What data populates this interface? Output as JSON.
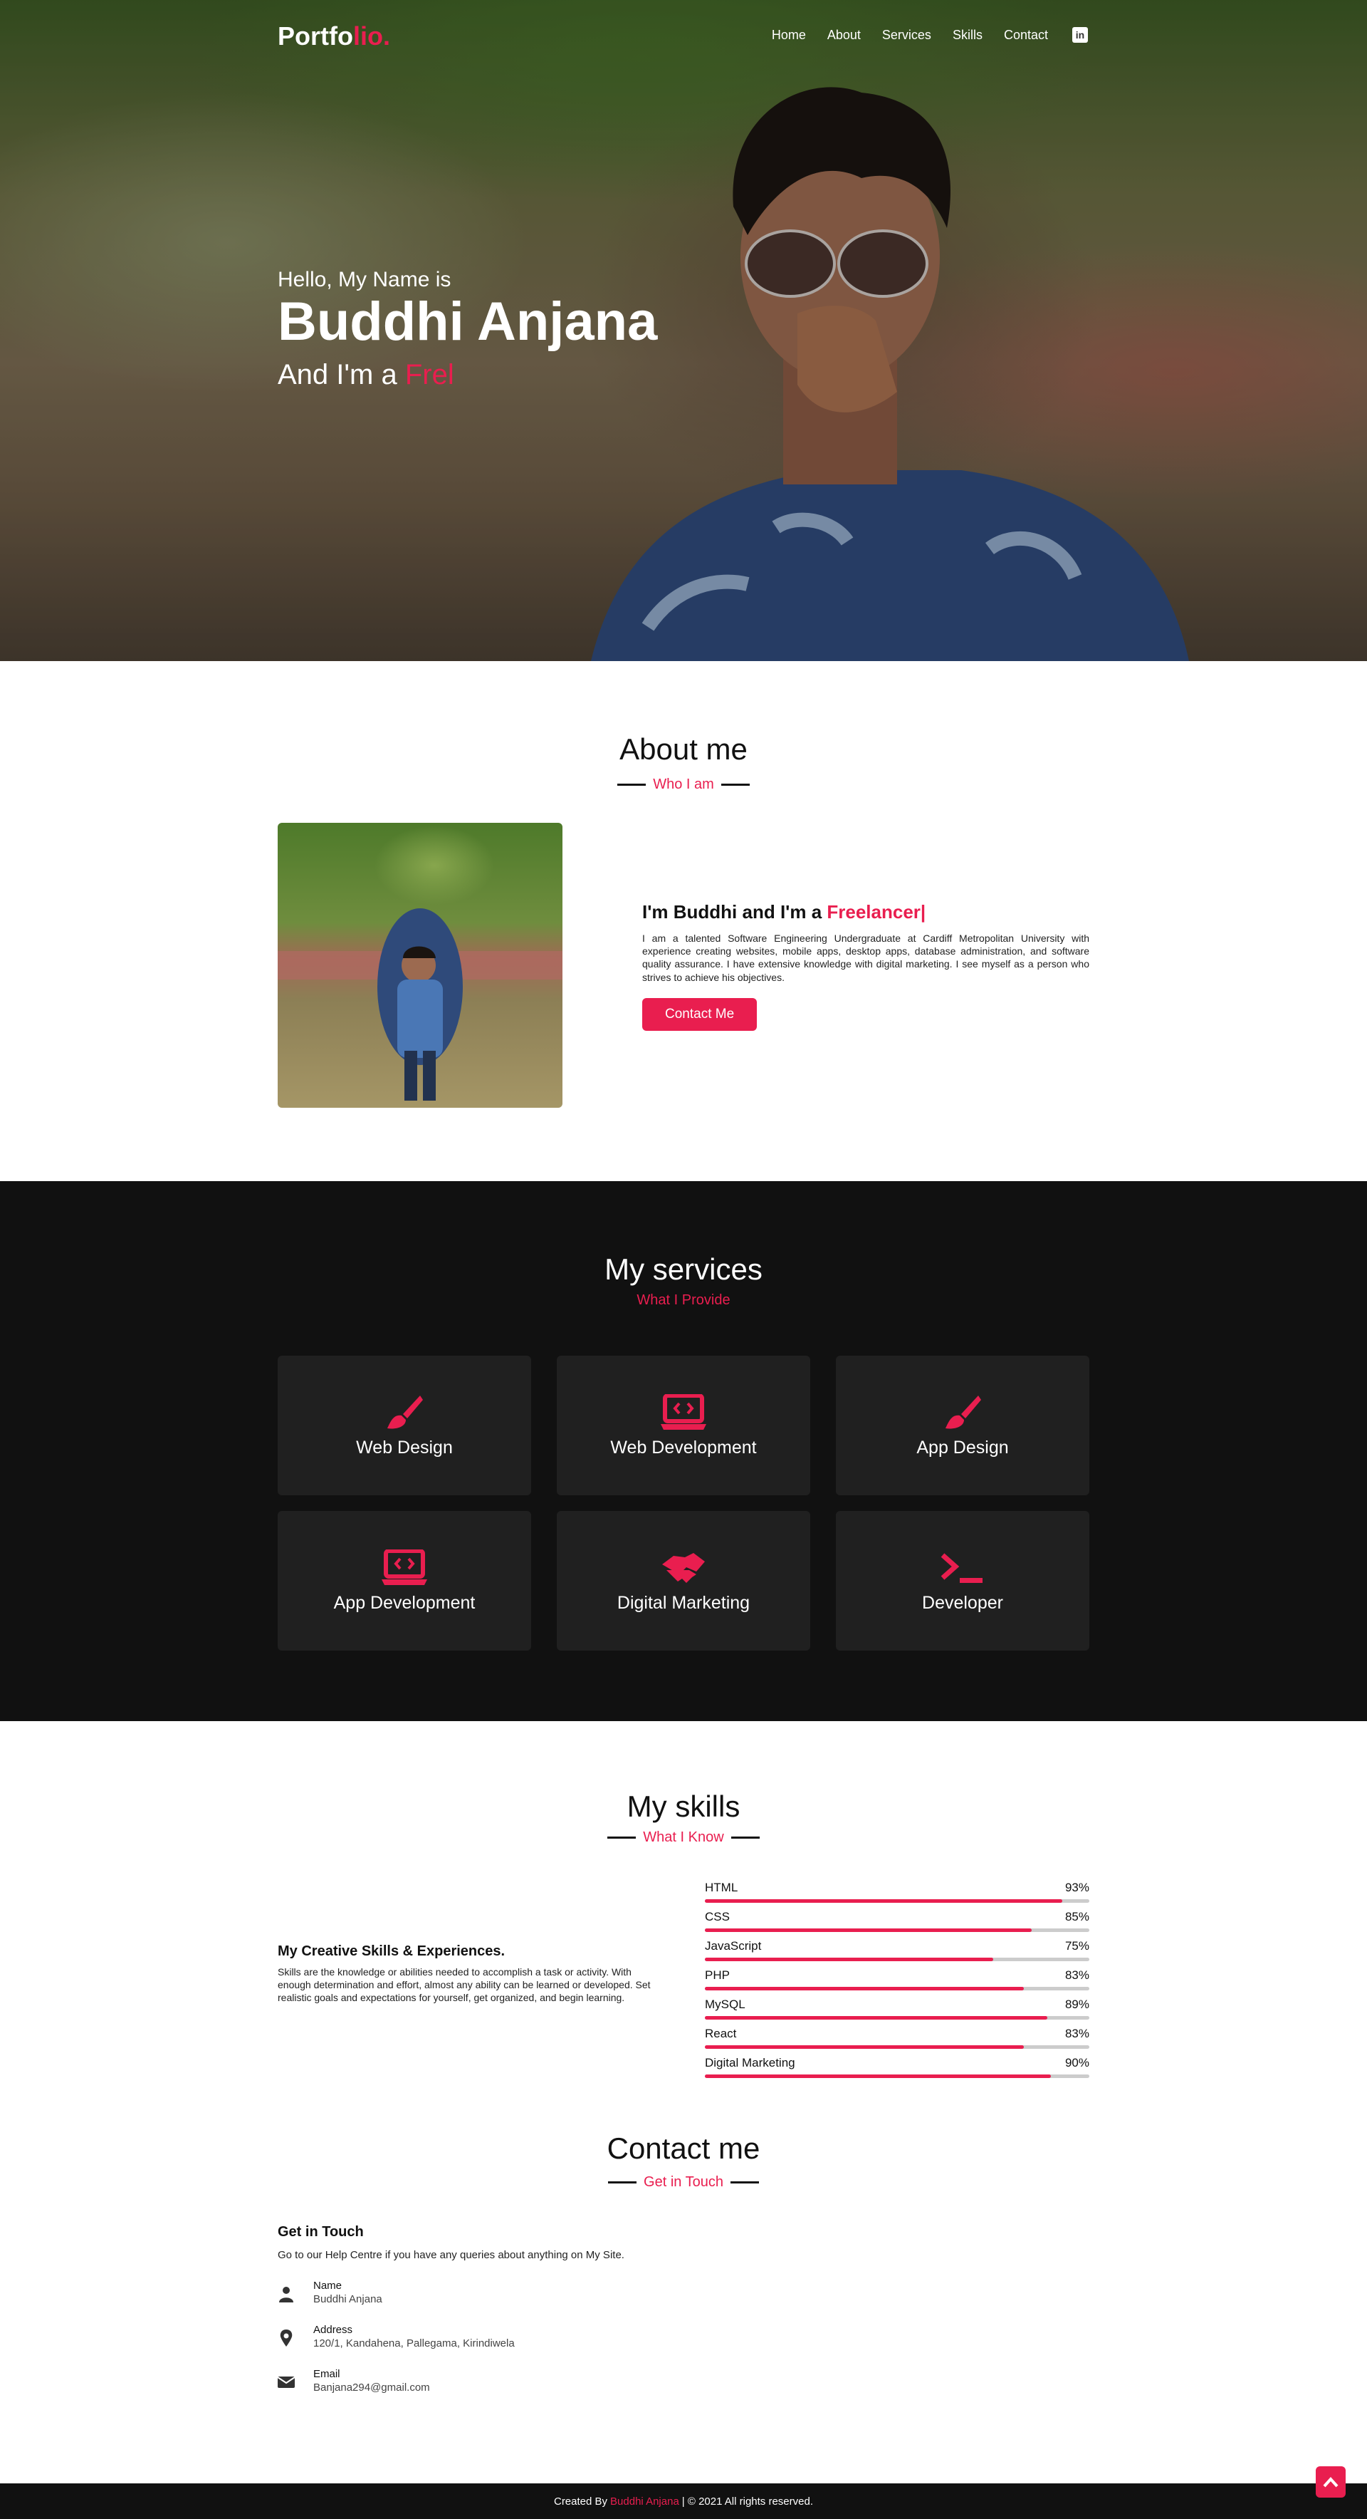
{
  "nav": {
    "brand_main": "Portfo",
    "brand_accent": "lio.",
    "links": [
      "Home",
      "About",
      "Services",
      "Skills",
      "Contact"
    ],
    "linkedin_glyph": "in"
  },
  "hero": {
    "hello": "Hello, My Name is",
    "name": "Buddhi Anjana",
    "role_prefix": "And I'm a",
    "role_typed": "Frel"
  },
  "about": {
    "title": "About me",
    "subtitle": "Who I am",
    "heading_prefix": "I'm Buddhi and I'm a",
    "heading_typed": "Freelancer|",
    "description": "I am a talented Software Engineering Undergraduate at Cardiff Metropolitan University with experience creating websites, mobile apps, desktop apps, database administration, and software quality assurance. I have extensive knowledge with digital marketing. I see myself as a person who strives to achieve his objectives.",
    "button": "Contact Me"
  },
  "services": {
    "title": "My services",
    "subtitle": "What I Provide",
    "items": [
      {
        "label": "Web Design",
        "icon": "paint-brush-icon"
      },
      {
        "label": "Web Development",
        "icon": "laptop-code-icon"
      },
      {
        "label": "App Design",
        "icon": "paint-brush-icon"
      },
      {
        "label": "App Development",
        "icon": "laptop-code-icon"
      },
      {
        "label": "Digital Marketing",
        "icon": "handshake-icon"
      },
      {
        "label": "Developer",
        "icon": "terminal-icon"
      }
    ]
  },
  "skills": {
    "title": "My skills",
    "subtitle": "What I Know",
    "heading": "My Creative Skills & Experiences.",
    "description": "Skills are the knowledge or abilities needed to accomplish a task or activity. With enough determination and effort, almost any ability can be learned or developed. Set realistic goals and expectations for yourself, get organized, and begin learning.",
    "items": [
      {
        "name": "HTML",
        "percent_label": "93%",
        "value": 93
      },
      {
        "name": "CSS",
        "percent_label": "85%",
        "value": 85
      },
      {
        "name": "JavaScript",
        "percent_label": "75%",
        "value": 75
      },
      {
        "name": "PHP",
        "percent_label": "83%",
        "value": 83
      },
      {
        "name": "MySQL",
        "percent_label": "89%",
        "value": 89
      },
      {
        "name": "React",
        "percent_label": "83%",
        "value": 83
      },
      {
        "name": "Digital Marketing",
        "percent_label": "90%",
        "value": 90
      }
    ]
  },
  "contact": {
    "title": "Contact me",
    "subtitle": "Get in Touch",
    "heading": "Get in Touch",
    "intro": "Go to our Help Centre if you have any queries about anything on My Site.",
    "name_label": "Name",
    "name_value": "Buddhi Anjana",
    "address_label": "Address",
    "address_value": "120/1, Kandahena, Pallegama, Kirindiwela",
    "email_label": "Email",
    "email_value": "Banjana294@gmail.com"
  },
  "footer": {
    "prefix": "Created By",
    "author": "Buddhi Anjana",
    "suffix": "| © 2021 All rights reserved."
  },
  "colors": {
    "accent": "#e91e4f",
    "dark": "#111111",
    "card": "#202020"
  }
}
